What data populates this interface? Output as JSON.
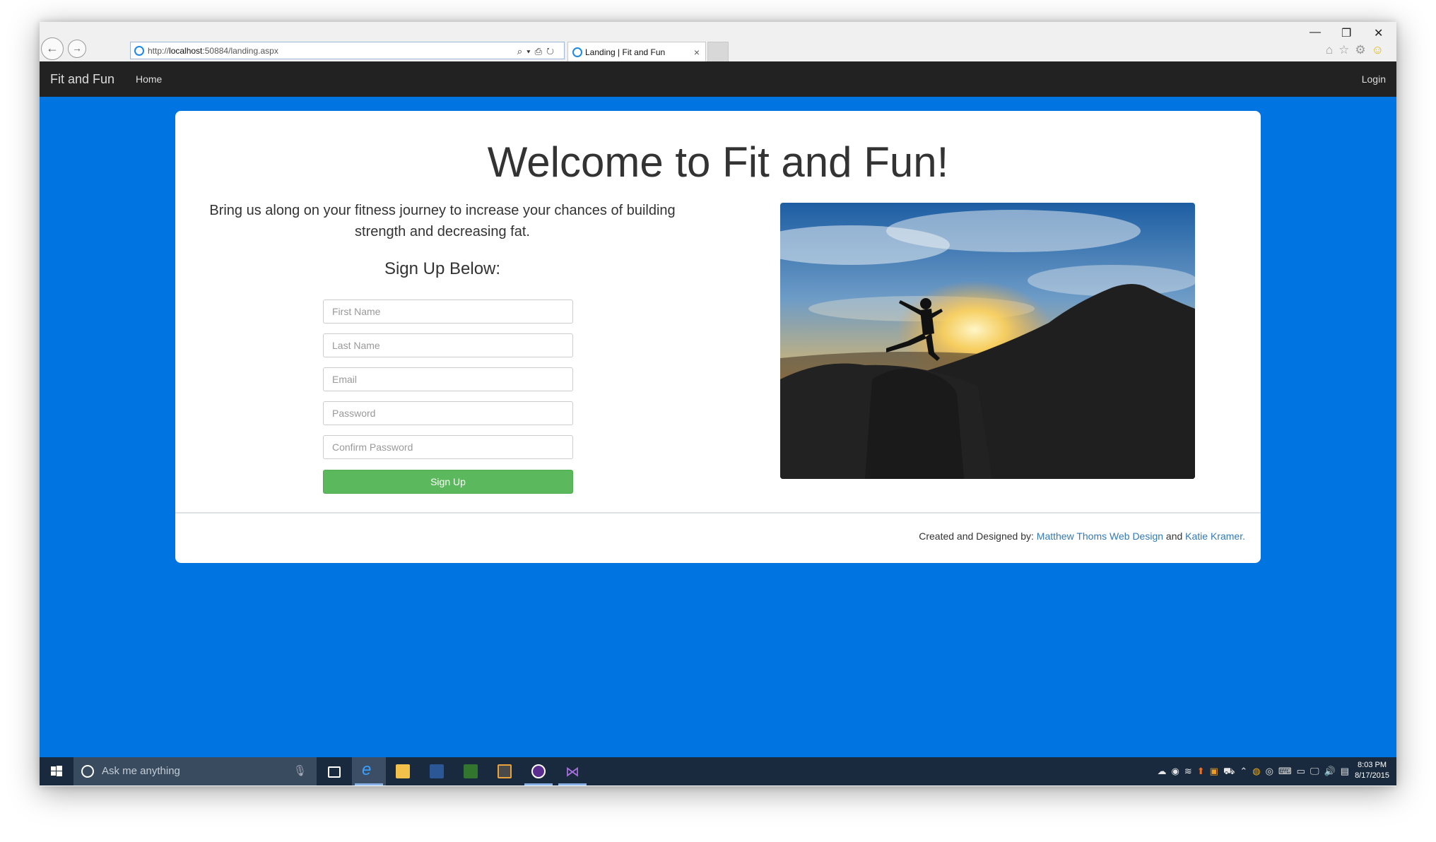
{
  "browser": {
    "address_prefix": "http://",
    "address_host": "localhost",
    "address_rest": ":50884/landing.aspx",
    "tab_title": "Landing | Fit and Fun",
    "tab_close": "×",
    "window_controls": {
      "minimize": "—",
      "restore": "❐",
      "close": "✕"
    },
    "toolbar_icons": [
      "home-icon",
      "star-icon",
      "gear-icon",
      "smiley-icon"
    ]
  },
  "navbar": {
    "brand": "Fit and Fun",
    "home": "Home",
    "login": "Login"
  },
  "hero": {
    "title": "Welcome to Fit and Fun!",
    "intro": "Bring us along on your fitness journey to increase your chances of building strength and decreasing fat.",
    "signup_heading": "Sign Up Below:"
  },
  "form": {
    "first_name_placeholder": "First Name",
    "last_name_placeholder": "Last Name",
    "email_placeholder": "Email",
    "password_placeholder": "Password",
    "confirm_password_placeholder": "Confirm Password",
    "submit_label": "Sign Up"
  },
  "footer": {
    "prefix": "Created and Designed by: ",
    "link1": "Matthew Thoms Web Design",
    "middle": " and ",
    "link2": "Katie Kramer.",
    "suffix": ""
  },
  "taskbar": {
    "search_placeholder": "Ask me anything",
    "apps": [
      "edge-icon",
      "file-explorer-icon",
      "word-icon",
      "project-icon",
      "sublime-icon",
      "app-icon",
      "visual-studio-icon"
    ],
    "time": "8:03 PM",
    "date": "8/17/2015"
  },
  "colors": {
    "page_background": "#0074e0",
    "navbar": "#222222",
    "signup_button": "#5cb85c",
    "link": "#337ab7",
    "taskbar": "#1a2a3e"
  }
}
